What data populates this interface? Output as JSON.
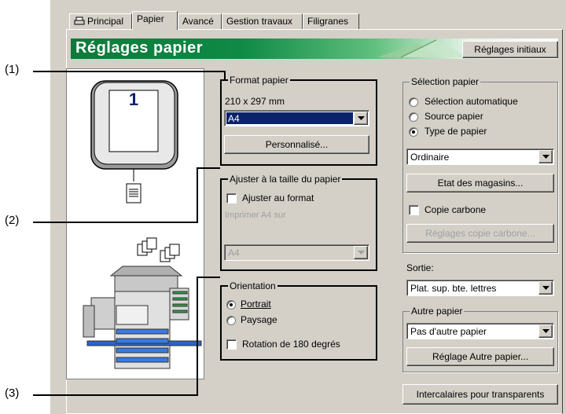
{
  "tabs": [
    "Principal",
    "Papier",
    "Avancé",
    "Gestion travaux",
    "Filigranes"
  ],
  "banner": {
    "title": "Réglages papier",
    "reset_label": "Réglages initiaux"
  },
  "callouts": [
    "(1)",
    "(2)",
    "(3)"
  ],
  "preview": {
    "page_number": "1"
  },
  "paper_format": {
    "legend": "Format papier",
    "size_text": "210 x 297 mm",
    "selected": "A4",
    "custom_label": "Personnalisé..."
  },
  "fit_to_page": {
    "legend": "Ajuster à la taille du papier",
    "fit_label": "Ajuster au format",
    "print_on_label": "Imprimer A4 sur",
    "print_on_value": "A4"
  },
  "orientation": {
    "legend": "Orientation",
    "portrait": "Portrait",
    "landscape": "Paysage",
    "rotate": "Rotation de 180 degrés"
  },
  "paper_selection": {
    "legend": "Sélection papier",
    "auto": "Sélection automatique",
    "source": "Source papier",
    "type": "Type de papier",
    "type_value": "Ordinaire",
    "trays_button": "Etat des magasins...",
    "carbon_label": "Copie carbone",
    "carbon_settings": "Réglages copie carbone..."
  },
  "output": {
    "label": "Sortie:",
    "value": "Plat. sup. bte. lettres"
  },
  "other_paper": {
    "legend": "Autre papier",
    "value": "Pas d'autre papier",
    "settings_button": "Réglage Autre papier..."
  },
  "transparency_button": "Intercalaires pour transparents",
  "colors": {
    "banner_green": "#0d7a3b",
    "selection_blue": "#0a246a",
    "dialog_gray": "#d4d0c8"
  }
}
